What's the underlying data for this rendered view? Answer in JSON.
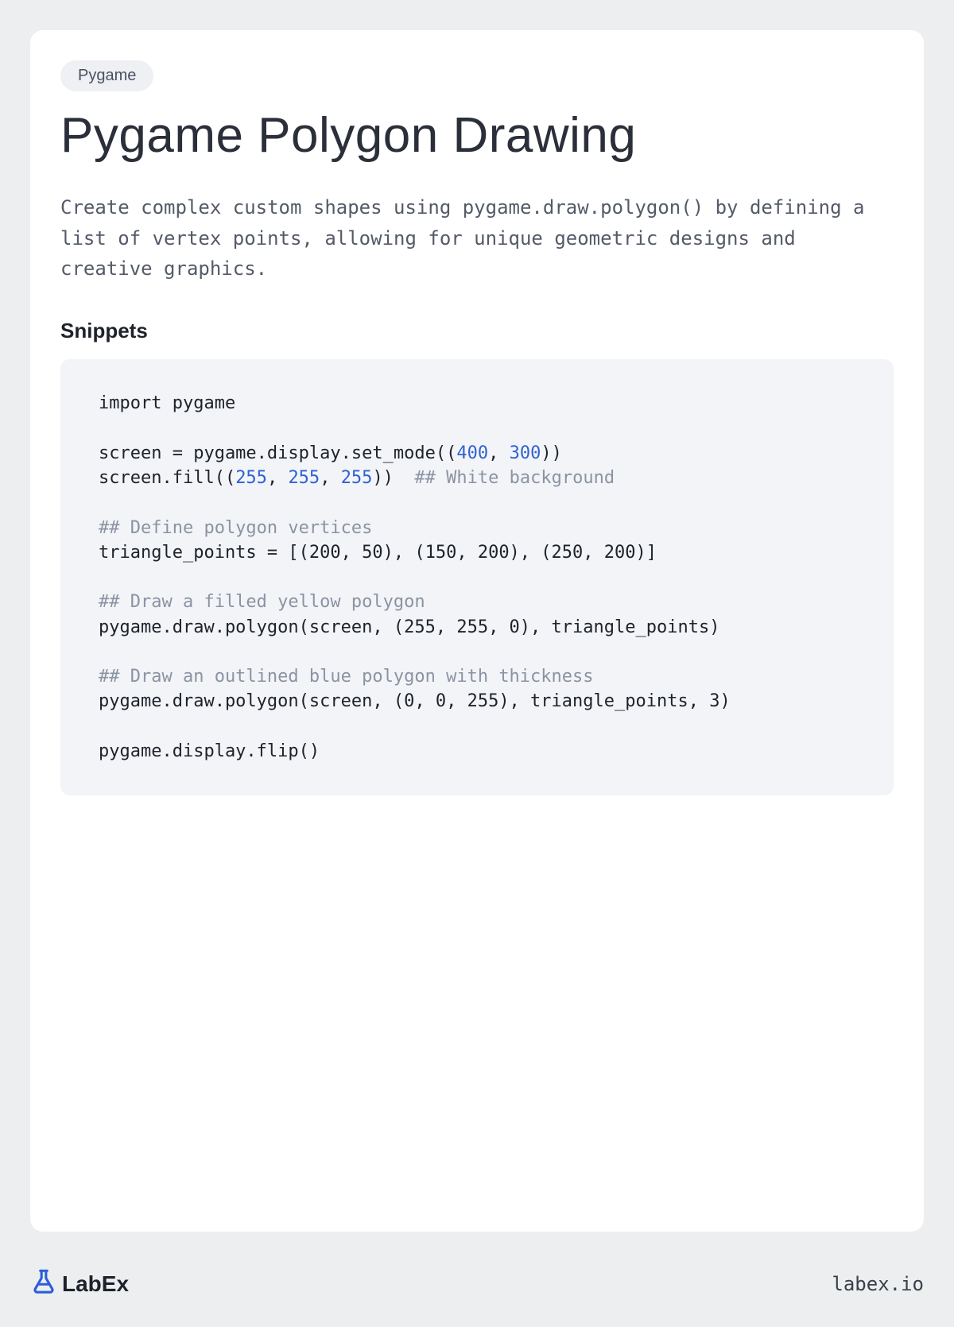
{
  "tag": "Pygame",
  "title": "Pygame Polygon Drawing",
  "description": "Create complex custom shapes using pygame.draw.polygon() by defining a list of vertex points, allowing for unique geometric designs and creative graphics.",
  "snippets_heading": "Snippets",
  "code": {
    "line1_kw_import": "import",
    "line1_rest": " pygame",
    "line3a": "screen = pygame.display.set_mode((",
    "line3_n1": "400",
    "line3_sep": ", ",
    "line3_n2": "300",
    "line3b": "))",
    "line4a": "screen.fill((",
    "line4_n1": "255",
    "line4_s1": ", ",
    "line4_n2": "255",
    "line4_s2": ", ",
    "line4_n3": "255",
    "line4b": "))  ",
    "line4_com": "## White background",
    "line6_com": "## Define polygon vertices",
    "line7": "triangle_points = [(200, 50), (150, 200), (250, 200)]",
    "line9_com": "## Draw a filled yellow polygon",
    "line10": "pygame.draw.polygon(screen, (255, 255, 0), triangle_points)",
    "line12_com": "## Draw an outlined blue polygon with thickness",
    "line13": "pygame.draw.polygon(screen, (0, 0, 255), triangle_points, 3)",
    "line15": "pygame.display.flip()"
  },
  "footer": {
    "brand": "LabEx",
    "url": "labex.io"
  }
}
